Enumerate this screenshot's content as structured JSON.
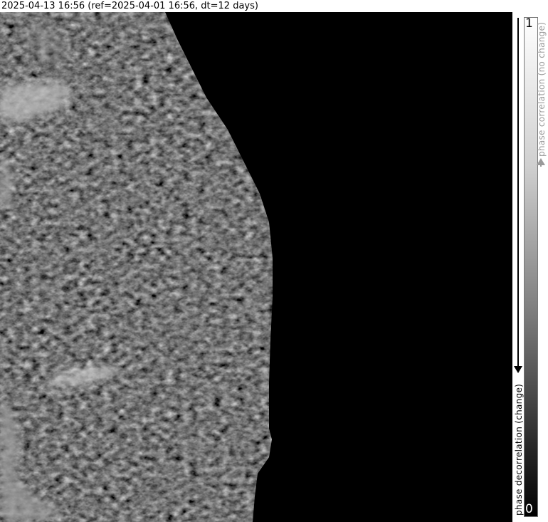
{
  "title": "2025-04-13 16:56 (ref=2025-04-01 16:56, dt=12 days)",
  "legend": {
    "max_value": "1",
    "min_value": "0",
    "top_label": "phase correlation (no change)",
    "bottom_label": "phase decorrelation (change)",
    "colormap": [
      "#000000",
      "#ffffff"
    ]
  },
  "colors": {
    "background": "#000000",
    "label_gray": "#9a9a9a"
  }
}
